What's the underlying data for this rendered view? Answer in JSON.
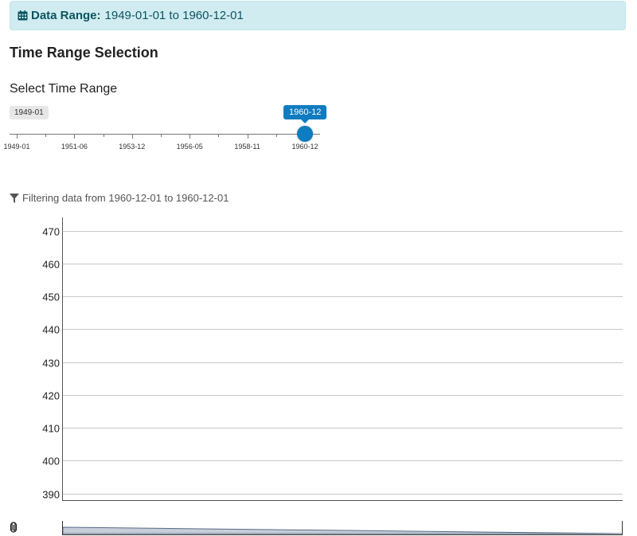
{
  "alert": {
    "icon": "calendar-icon",
    "label": "Data Range:",
    "value": "1949-01-01 to 1960-12-01"
  },
  "section": {
    "title": "Time Range Selection"
  },
  "slider": {
    "label": "Select Time Range",
    "min_label": "1949-01",
    "current_label": "1960-12",
    "current_fraction": 1.0,
    "tick_labels": [
      "1949-01",
      "1951-06",
      "1953-12",
      "1956-05",
      "1958-11",
      "1960-12"
    ],
    "accent_color": "#0f7bc0"
  },
  "filter_note": {
    "icon": "filter-icon",
    "text": "Filtering data from 1960-12-01 to 1960-12-01"
  },
  "chart_data": {
    "type": "area",
    "title": "",
    "xlabel": "",
    "ylabel": "",
    "ylim": [
      388,
      474
    ],
    "y_ticks": [
      470,
      460,
      450,
      440,
      430,
      420,
      410,
      400,
      390
    ],
    "grid": true,
    "series": [],
    "navigator": {
      "present": true
    }
  },
  "footer": {
    "icon": "paperclip-icon"
  }
}
